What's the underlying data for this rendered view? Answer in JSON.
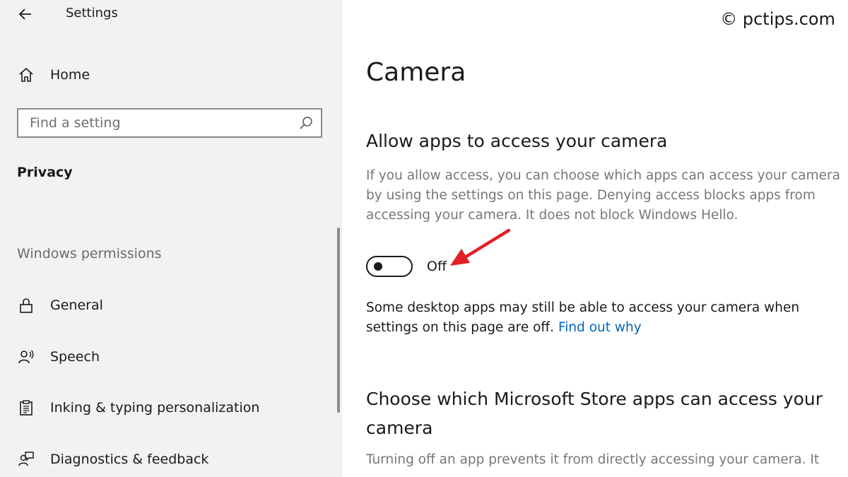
{
  "window": {
    "title": "Settings"
  },
  "sidebar": {
    "home_label": "Home",
    "search": {
      "placeholder": "Find a setting",
      "value": ""
    },
    "section_title": "Privacy",
    "group_heading": "Windows permissions",
    "items": [
      {
        "label": "General",
        "icon": "lock-icon"
      },
      {
        "label": "Speech",
        "icon": "speech-icon"
      },
      {
        "label": "Inking & typing personalization",
        "icon": "clipboard-icon"
      },
      {
        "label": "Diagnostics & feedback",
        "icon": "feedback-icon"
      }
    ]
  },
  "main": {
    "page_title": "Camera",
    "allow": {
      "heading": "Allow apps to access your camera",
      "description": "If you allow access, you can choose which apps can access your camera by using the settings on this page. Denying access blocks apps from accessing your camera. It does not block Windows Hello.",
      "toggle_state": "Off",
      "toggle_on": false
    },
    "note": {
      "text": "Some desktop apps may still be able to access your camera when settings on this page are off. ",
      "link": "Find out why"
    },
    "store": {
      "heading": "Choose which Microsoft Store apps can access your camera",
      "description": "Turning off an app prevents it from directly accessing your camera. It"
    }
  },
  "watermark": "© pctips.com",
  "colors": {
    "sidebar_bg": "#f2f2f2",
    "link": "#0067b8",
    "annotation_arrow": "#e31e24",
    "muted_text": "#777777"
  }
}
